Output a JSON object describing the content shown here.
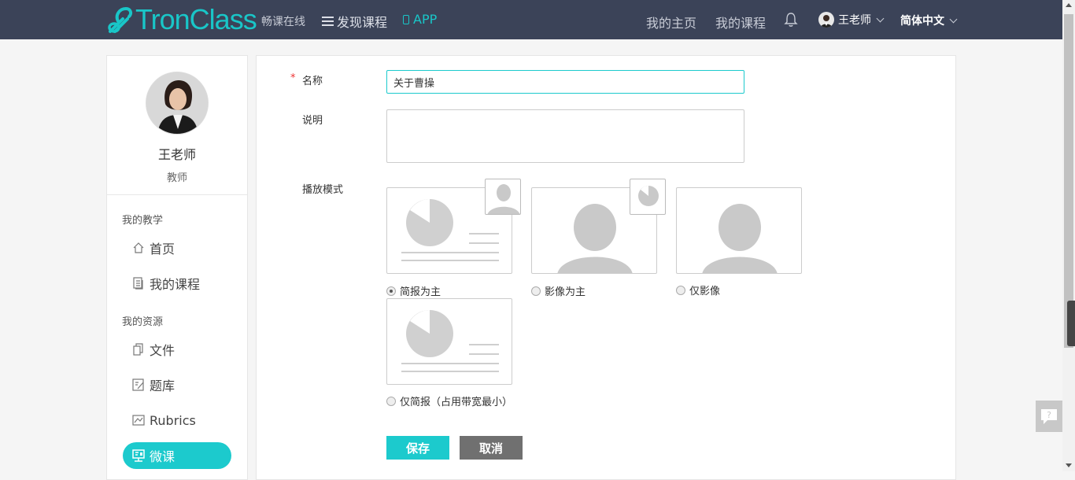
{
  "header": {
    "logo_text": "TronClass",
    "slogan": "畅课在线",
    "discover_label": "发现课程",
    "app_label": "APP",
    "my_home": "我的主页",
    "my_courses": "我的课程",
    "user_name": "王老师",
    "language": "简体中文"
  },
  "sidebar": {
    "name": "王老师",
    "role": "教师",
    "section_teaching": "我的教学",
    "section_resources": "我的资源",
    "items": [
      {
        "label": "首页",
        "icon": "home-icon"
      },
      {
        "label": "我的课程",
        "icon": "course-doc-icon"
      },
      {
        "label": "文件",
        "icon": "files-icon"
      },
      {
        "label": "题库",
        "icon": "question-bank-icon"
      },
      {
        "label": "Rubrics",
        "icon": "rubrics-icon"
      },
      {
        "label": "微课",
        "icon": "micro-lecture-icon",
        "active": true
      }
    ]
  },
  "form": {
    "name_label": "名称",
    "required_mark": "*",
    "name_value": "关于曹操",
    "description_label": "说明",
    "description_value": "",
    "play_mode_label": "播放模式",
    "modes": [
      {
        "label": "简报为主",
        "selected": true
      },
      {
        "label": "影像为主",
        "selected": false
      },
      {
        "label": "仅影像",
        "selected": false
      },
      {
        "label": "仅简报（占用带宽最小）",
        "selected": false
      }
    ],
    "save_label": "保存",
    "cancel_label": "取消"
  },
  "help": {
    "label": "?"
  },
  "colors": {
    "header_bg": "#3b4358",
    "accent": "#1ccacd",
    "cancel": "#707070",
    "required": "#ee3333"
  }
}
